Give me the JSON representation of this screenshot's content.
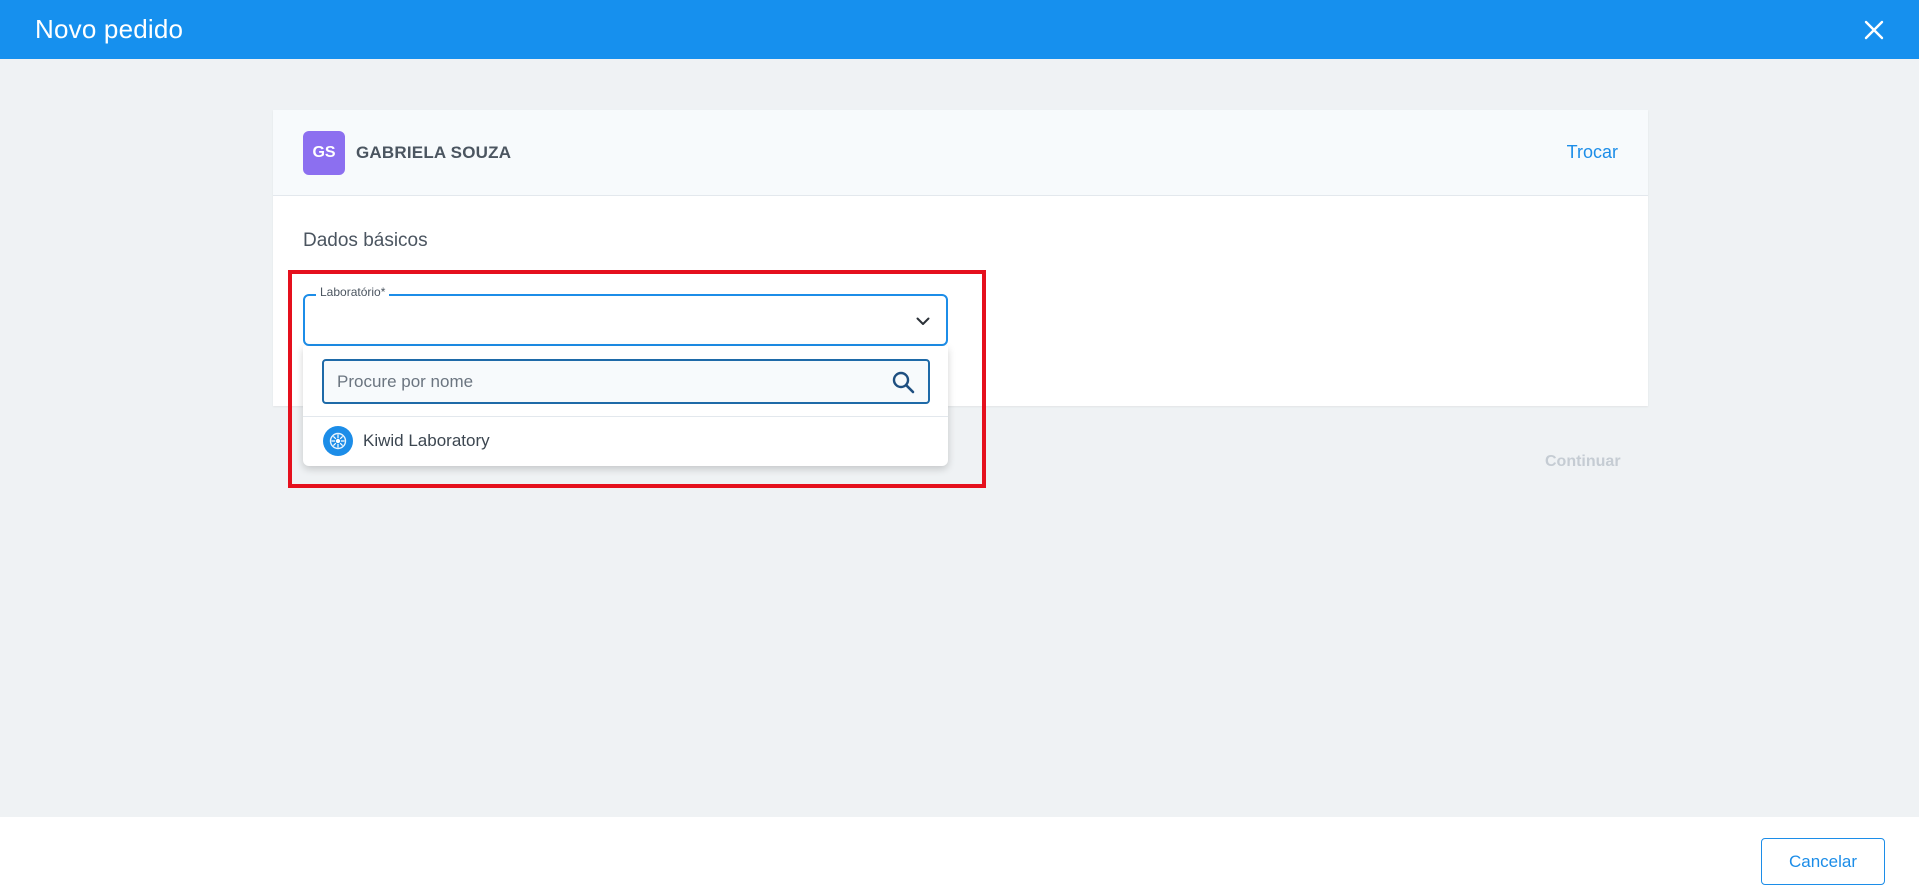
{
  "header": {
    "title": "Novo pedido",
    "close_icon": "close-icon"
  },
  "customer": {
    "initials": "GS",
    "name": "GABRIELA SOUZA",
    "swap_label": "Trocar",
    "avatar_color": "#8c6ff0"
  },
  "form": {
    "section_title": "Dados básicos",
    "laboratory_label": "Laboratório*",
    "laboratory_value": ""
  },
  "dropdown": {
    "search_placeholder": "Procure por nome",
    "options": [
      {
        "label": "Kiwid Laboratory",
        "icon": "lab-logo-icon"
      }
    ]
  },
  "actions": {
    "continue_label": "Continuar",
    "cancel_label": "Cancelar"
  },
  "colors": {
    "accent": "#1690ee",
    "highlight": "#e5101d",
    "disabled_text": "#c5ccd3"
  }
}
